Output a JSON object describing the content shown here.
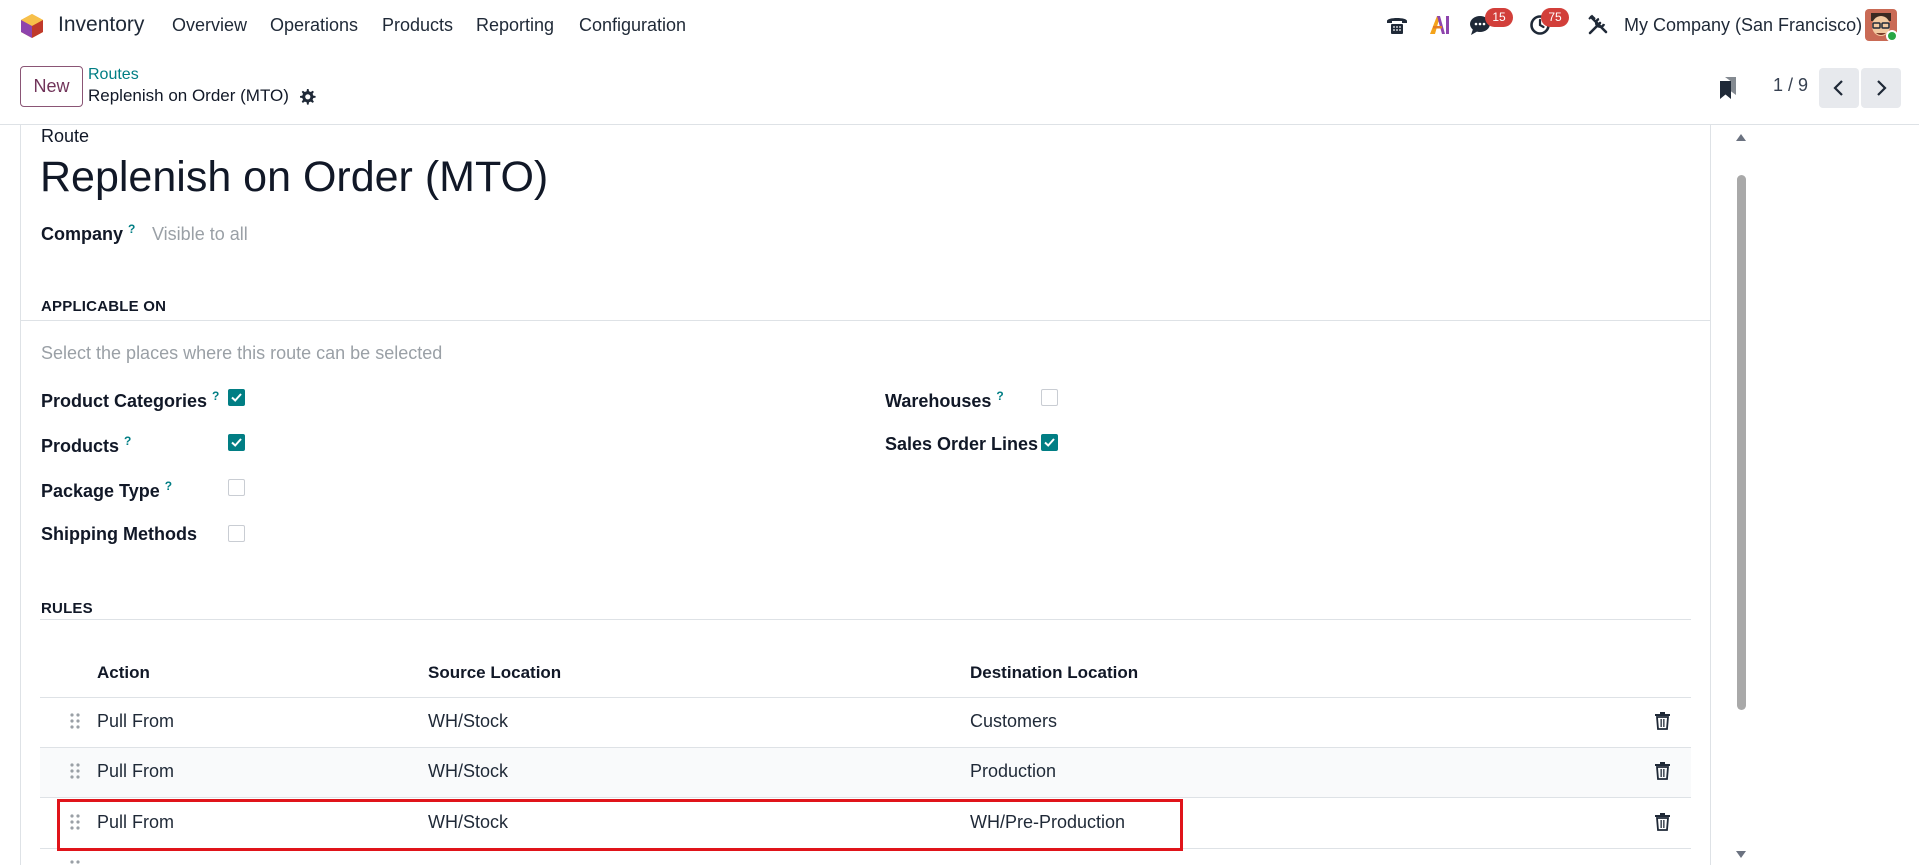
{
  "navbar": {
    "app_name": "Inventory",
    "menu": [
      "Overview",
      "Operations",
      "Products",
      "Reporting",
      "Configuration"
    ],
    "messages_count": "15",
    "activities_count": "75",
    "company": "My Company (San Francisco)",
    "icons": [
      "phone-icon",
      "ai-icon",
      "chat-icon",
      "clock-icon",
      "tools-icon"
    ]
  },
  "control_panel": {
    "new_label": "New",
    "breadcrumb_parent": "Routes",
    "breadcrumb_current": "Replenish on Order (MTO)",
    "pager": "1 / 9"
  },
  "form": {
    "route_label": "Route",
    "route_name": "Replenish on Order (MTO)",
    "company_label": "Company",
    "company_value": "Visible to all",
    "help_mark": "?"
  },
  "applicable_on": {
    "title": "APPLICABLE ON",
    "helper": "Select the places where this route can be selected",
    "left": [
      {
        "label": "Product Categories",
        "help": true,
        "checked": true
      },
      {
        "label": "Products",
        "help": true,
        "checked": true
      },
      {
        "label": "Package Type",
        "help": true,
        "checked": false
      },
      {
        "label": "Shipping Methods",
        "help": false,
        "checked": false
      }
    ],
    "right": [
      {
        "label": "Warehouses",
        "help": true,
        "checked": false
      },
      {
        "label": "Sales Order Lines",
        "help": false,
        "checked": true
      }
    ]
  },
  "rules": {
    "title": "RULES",
    "columns": [
      "Action",
      "Source Location",
      "Destination Location"
    ],
    "rows": [
      {
        "action": "Pull From",
        "source": "WH/Stock",
        "destination": "Customers"
      },
      {
        "action": "Pull From",
        "source": "WH/Stock",
        "destination": "Production"
      },
      {
        "action": "Pull From",
        "source": "WH/Stock",
        "destination": "WH/Pre-Production"
      }
    ]
  },
  "colors": {
    "accent": "#017e84",
    "brand": "#71345a",
    "badge": "#d23f3a",
    "highlight": "#e0141a"
  }
}
